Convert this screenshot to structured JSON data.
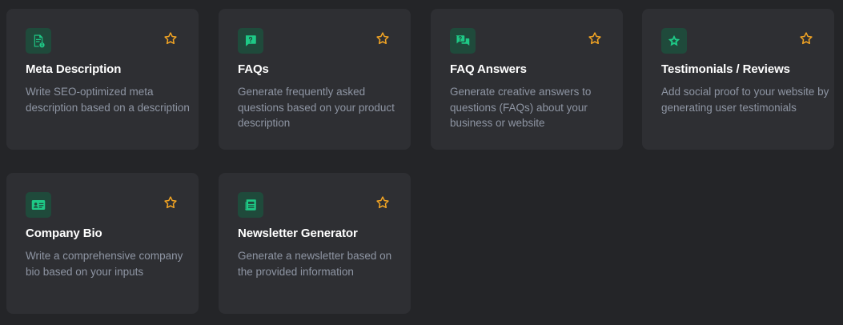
{
  "colors": {
    "background": "#242528",
    "card": "#2e2f33",
    "icon_bg": "#1f4a3b",
    "icon_fg": "#1ec986",
    "star": "#f5a623",
    "title": "#ffffff",
    "description": "#8e95a3"
  },
  "cards": [
    {
      "icon": "document-info-icon",
      "title": "Meta Description",
      "description": "Write SEO-optimized meta description based on a description",
      "favorite": false
    },
    {
      "icon": "question-chat-icon",
      "title": "FAQs",
      "description": "Generate frequently asked questions based on your product description",
      "favorite": false
    },
    {
      "icon": "question-answer-chat-icon",
      "title": "FAQ Answers",
      "description": "Generate creative answers to questions (FAQs) about your business or website",
      "favorite": false
    },
    {
      "icon": "star-badge-icon",
      "title": "Testimonials / Reviews",
      "description": "Add social proof to your website by generating user testimonials",
      "favorite": false
    },
    {
      "icon": "id-card-icon",
      "title": "Company Bio",
      "description": "Write a comprehensive company bio based on your inputs",
      "favorite": false
    },
    {
      "icon": "newspaper-icon",
      "title": "Newsletter Generator",
      "description": "Generate a newsletter based on the provided information",
      "favorite": false
    }
  ]
}
